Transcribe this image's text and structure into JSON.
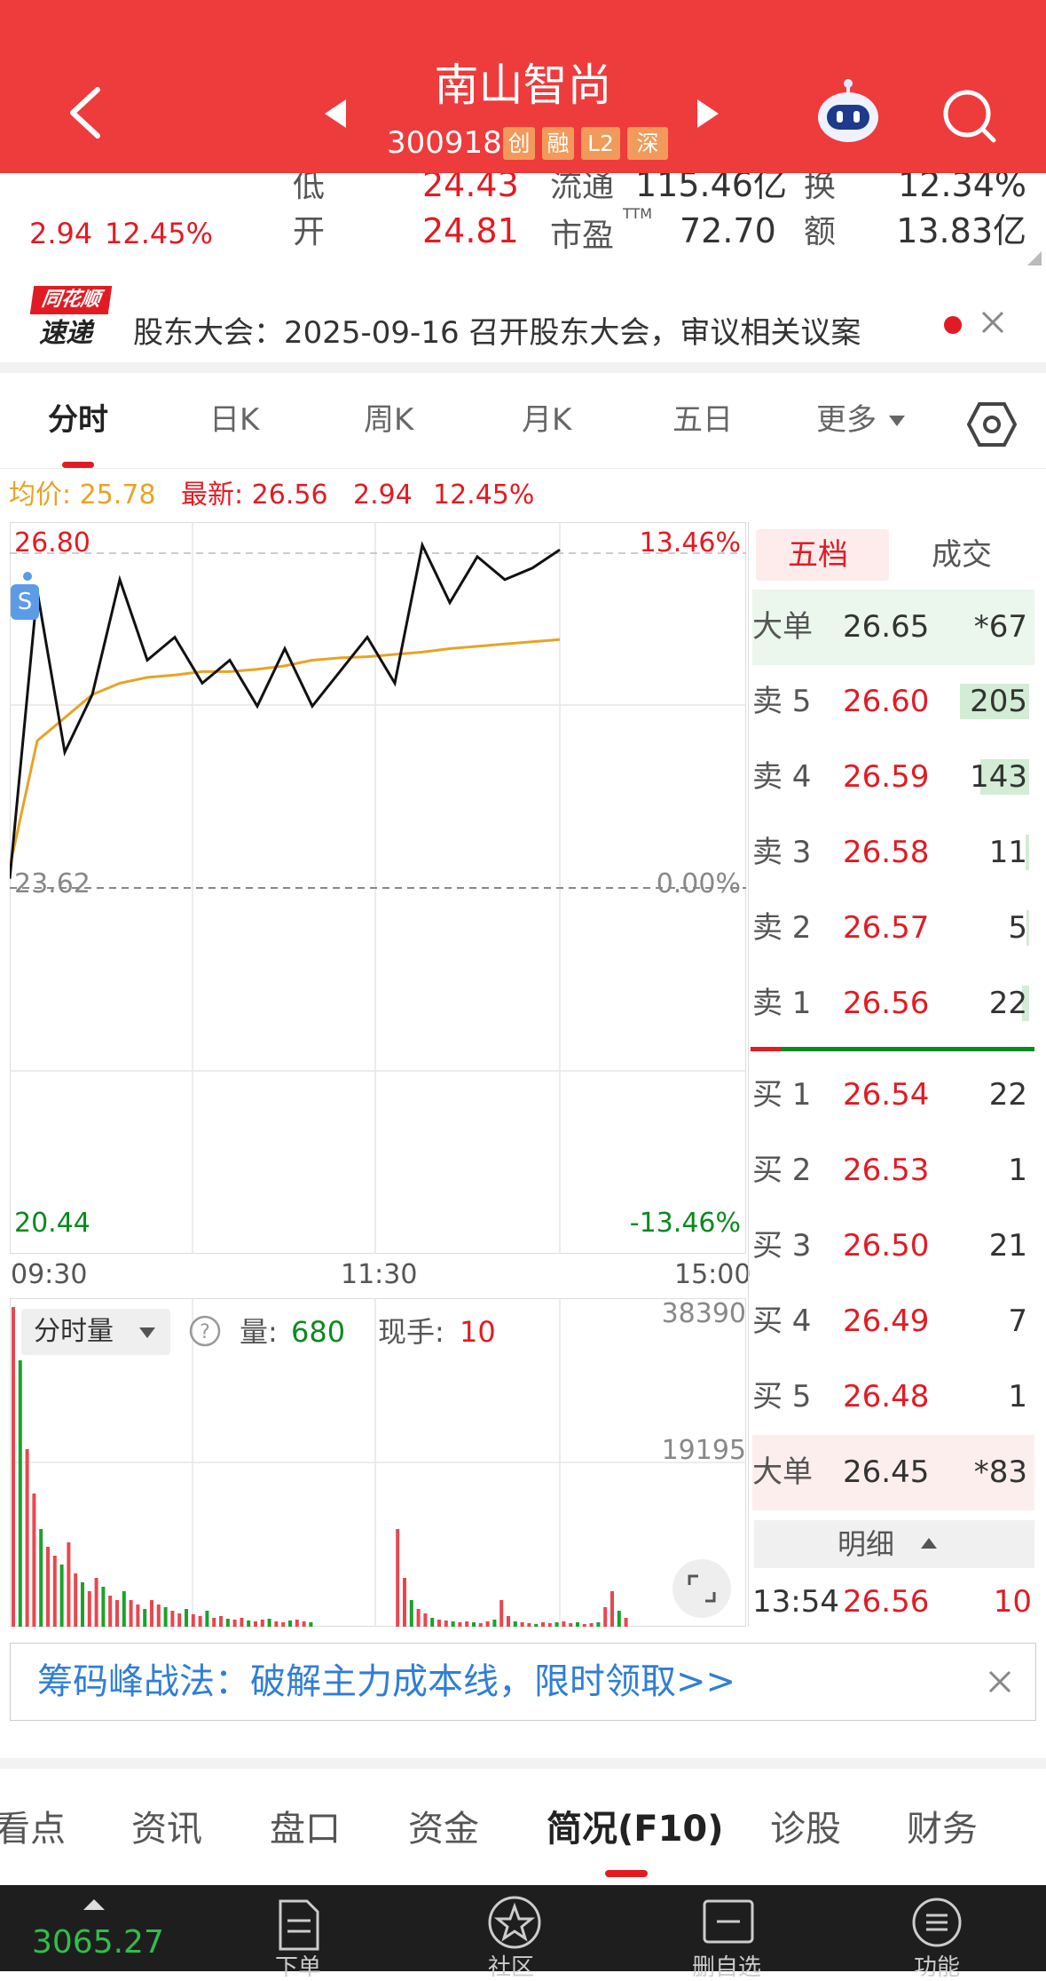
{
  "header": {
    "title": "南山智尚",
    "code": "300918",
    "tags": [
      "创",
      "融",
      "L2",
      "深股"
    ]
  },
  "quote": {
    "change": "2.94",
    "change_pct": "12.45%",
    "low_label": "低",
    "low_value": "24.43",
    "open_label": "开",
    "open_value": "24.81",
    "float_label": "流通",
    "float_value": "115.46亿",
    "pe_label": "市盈",
    "pe_sup": "TTM",
    "pe_value": "72.70",
    "turnover_label": "换",
    "turnover_value": "12.34%",
    "amount_label": "额",
    "amount_value": "13.83亿"
  },
  "news": {
    "logo_top": "同花顺",
    "logo_bottom": "速递",
    "text": "股东大会：2025-09-16 召开股东大会，审议相关议案"
  },
  "tabs": [
    "分时",
    "日K",
    "周K",
    "月K",
    "五日",
    "更多"
  ],
  "chart": {
    "avg_label": "均价: 25.78",
    "latest_label": "最新: 26.56",
    "latest_change": "2.94",
    "latest_pct": "12.45%",
    "y_top": "26.80",
    "y_mid": "23.62",
    "y_bottom": "20.44",
    "pct_top": "13.46%",
    "pct_mid": "0.00%",
    "pct_bottom": "-13.46%",
    "x_labels": [
      "09:30",
      "11:30",
      "15:00"
    ],
    "s_badge": "S"
  },
  "chart_data": {
    "type": "line",
    "series": [
      {
        "name": "均价",
        "values": [
          23.8,
          24.9,
          25.1,
          25.3,
          25.4,
          25.45,
          25.47,
          25.5,
          25.5,
          25.52,
          25.55,
          25.6,
          25.62,
          25.63,
          25.65,
          25.67,
          25.7,
          25.72,
          25.74,
          25.76,
          25.78
        ]
      },
      {
        "name": "最新",
        "values": [
          23.7,
          26.2,
          24.8,
          25.3,
          26.3,
          25.6,
          25.8,
          25.4,
          25.6,
          25.2,
          25.7,
          25.2,
          25.5,
          25.8,
          25.4,
          26.6,
          26.1,
          26.5,
          26.3,
          26.4,
          26.56
        ]
      }
    ],
    "ylim": [
      20.44,
      26.8
    ],
    "volume": {
      "y_max": "38390",
      "y_mid": "19195"
    }
  },
  "volume_panel": {
    "selector": "分时量",
    "vol_label": "量:",
    "vol_value": "680",
    "hand_label": "现手:",
    "hand_value": "10"
  },
  "orderbook": {
    "tabs": [
      "五档",
      "成交"
    ],
    "big_top": {
      "label": "大单",
      "price": "26.65",
      "vol": "*67"
    },
    "asks": [
      {
        "label": "卖 5",
        "price": "26.60",
        "vol": "205",
        "bar": 0.6
      },
      {
        "label": "卖 4",
        "price": "26.59",
        "vol": "143",
        "bar": 0.42
      },
      {
        "label": "卖 3",
        "price": "26.58",
        "vol": "11",
        "bar": 0.03
      },
      {
        "label": "卖 2",
        "price": "26.57",
        "vol": "5",
        "bar": 0.01
      },
      {
        "label": "卖 1",
        "price": "26.56",
        "vol": "22",
        "bar": 0.06
      }
    ],
    "bids": [
      {
        "label": "买 1",
        "price": "26.54",
        "vol": "22"
      },
      {
        "label": "买 2",
        "price": "26.53",
        "vol": "1"
      },
      {
        "label": "买 3",
        "price": "26.50",
        "vol": "21"
      },
      {
        "label": "买 4",
        "price": "26.49",
        "vol": "7"
      },
      {
        "label": "买 5",
        "price": "26.48",
        "vol": "1"
      }
    ],
    "big_bottom": {
      "label": "大单",
      "price": "26.45",
      "vol": "*83"
    },
    "detail_label": "明细",
    "trade": {
      "time": "13:54",
      "price": "26.56",
      "vol": "10"
    }
  },
  "promo": {
    "text": "筹码峰战法：破解主力成本线，限时领取>>"
  },
  "bottom_tabs": [
    "看点",
    "资讯",
    "盘口",
    "资金",
    "简况(F10)",
    "诊股",
    "财务"
  ],
  "dock": {
    "index_value": "3065.27",
    "items": [
      "下单",
      "社区",
      "删自选",
      "功能"
    ]
  }
}
